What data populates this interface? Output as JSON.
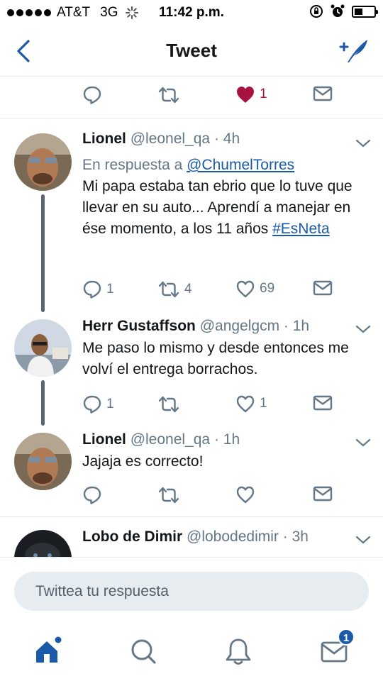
{
  "status_bar": {
    "carrier": "AT&T",
    "network": "3G",
    "time": "11:42 p.m."
  },
  "nav": {
    "title": "Tweet",
    "back_icon": "chevron-left-icon",
    "compose_icon": "compose-tweet-icon"
  },
  "main_actions": {
    "like_count": "1",
    "like_color": "#a8123f"
  },
  "tweets": [
    {
      "name": "Lionel",
      "handle": "@leonel_qa",
      "time": "· 4h",
      "reply_prefix": "En respuesta a",
      "reply_to": "@ChumelTorres",
      "text": "Mi papa estaba tan ebrio que lo tuve que llevar en su auto... Aprendí a manejar en ése momento, a los 11 años",
      "hashtag": "#EsNeta",
      "reply_count": "1",
      "retweet_count": "4",
      "like_count": "69"
    },
    {
      "name": "Herr Gustaffson",
      "handle": "@angelgcm",
      "time": "· 1h",
      "text": "Me paso lo mismo y desde entonces me volví el entrega borrachos.",
      "reply_count": "1",
      "retweet_count": "",
      "like_count": "1"
    },
    {
      "name": "Lionel",
      "handle": "@leonel_qa",
      "time": "· 1h",
      "text": "Jajaja es correcto!",
      "reply_count": "",
      "retweet_count": "",
      "like_count": ""
    },
    {
      "name": "Lobo de Dimir",
      "handle": "@lobodedimir",
      "time": "· 3h"
    }
  ],
  "reply_box": {
    "placeholder": "Twittea tu respuesta"
  },
  "tab_bar": {
    "items": [
      "home-icon",
      "search-icon",
      "notifications-icon",
      "messages-icon"
    ],
    "messages_badge": "1",
    "accent": "#1b5aa8"
  }
}
